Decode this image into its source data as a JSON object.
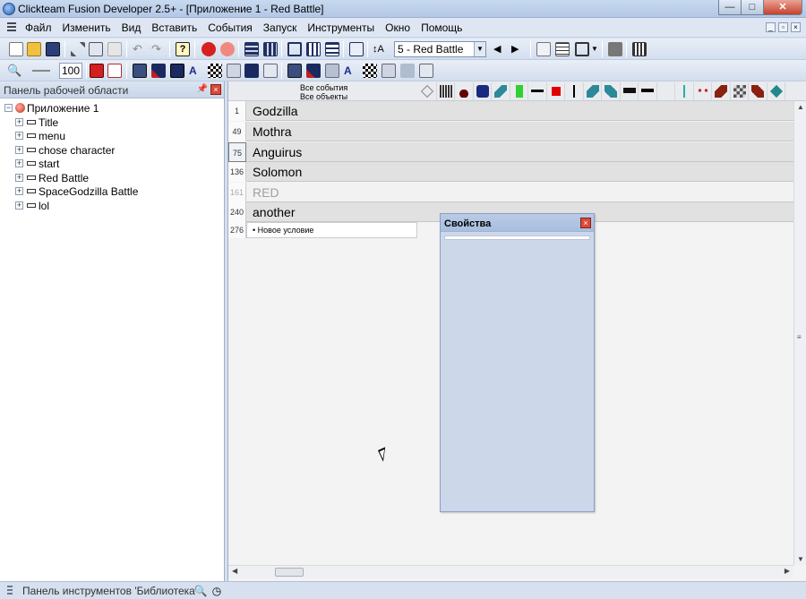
{
  "window": {
    "title": "Clickteam Fusion Developer 2.5+ - [Приложение 1 - Red Battle]",
    "minimize": "—",
    "maximize": "□",
    "close": "✕"
  },
  "menu": [
    "Файл",
    "Изменить",
    "Вид",
    "Вставить",
    "События",
    "Запуск",
    "Инструменты",
    "Окно",
    "Помощь"
  ],
  "toolbar": {
    "frame_select_value": "5 - Red Battle",
    "zoom_value": "100"
  },
  "workspace": {
    "header": "Панель рабочей области",
    "root": "Приложение 1",
    "frames": [
      "Title",
      "menu",
      "chose character",
      "start",
      "Red Battle",
      "SpaceGodzilla Battle",
      "lol"
    ]
  },
  "editor": {
    "header_line1": "Все события",
    "header_line2": "Все объекты",
    "groups": [
      {
        "num": "1",
        "label": "Godzilla",
        "state": "normal"
      },
      {
        "num": "49",
        "label": "Mothra",
        "state": "normal"
      },
      {
        "num": "75",
        "label": "Anguirus",
        "state": "selected"
      },
      {
        "num": "136",
        "label": "Solomon",
        "state": "normal"
      },
      {
        "num": "161",
        "label": "RED",
        "state": "disabled"
      },
      {
        "num": "240",
        "label": "another",
        "state": "normal"
      }
    ],
    "new_row_num": "276",
    "new_condition": "Новое условие"
  },
  "properties": {
    "title": "Свойства"
  },
  "library_bar": {
    "label": "Панель инструментов 'Библиотека'"
  },
  "colors": {
    "accent": "#c6412c",
    "group_bg": "#e1e1e1",
    "panel_bg": "#ccd7e9"
  }
}
